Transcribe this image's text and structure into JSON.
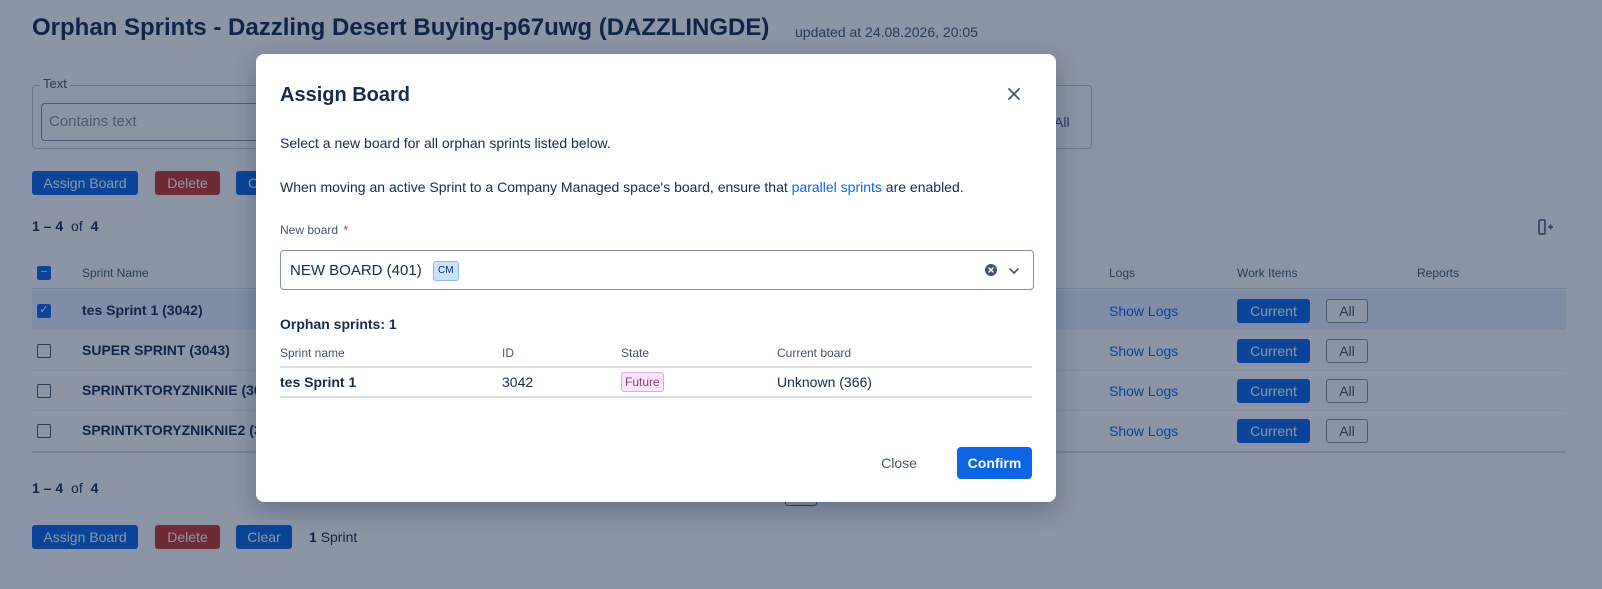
{
  "page": {
    "title": "Orphan Sprints - Dazzling Desert Buying-p67uwg (DAZZLINGDE)",
    "updated": "updated at 24.08.2026, 20:05"
  },
  "filters": {
    "text_legend": "Text",
    "text_placeholder": "Contains text",
    "all_label": "All"
  },
  "toolbar": {
    "assign_label": "Assign Board",
    "delete_label": "Delete",
    "clear_label": "Clear",
    "clear_partial": "C"
  },
  "pagination": {
    "range": "1 – 4",
    "of": "of",
    "total": "4"
  },
  "table": {
    "headers": {
      "sprint_name": "Sprint Name",
      "logs": "Logs",
      "work_items": "Work Items",
      "reports": "Reports"
    },
    "rows": [
      {
        "name": "tes Sprint 1 (3042)",
        "checked": true,
        "logs": "Show Logs",
        "current": "Current",
        "all": "All"
      },
      {
        "name": "SUPER SPRINT (3043)",
        "checked": false,
        "logs": "Show Logs",
        "current": "Current",
        "all": "All"
      },
      {
        "name": "SPRINTKTORYZNIKNIE (30",
        "checked": false,
        "logs": "Show Logs",
        "current": "Current",
        "all": "All"
      },
      {
        "name": "SPRINTKTORYZNIKNIE2 (3",
        "checked": false,
        "logs": "Show Logs",
        "current": "Current",
        "all": "All"
      }
    ]
  },
  "bottom": {
    "selected_count": "1",
    "selected_unit": "Sprint"
  },
  "modal": {
    "title": "Assign Board",
    "description": "Select a new board for all orphan sprints listed below.",
    "note_before": "When moving an active Sprint to a Company Managed space's board, ensure that",
    "note_link": "parallel sprints",
    "note_after": "are enabled.",
    "field_label": "New board",
    "required_mark": "*",
    "selected_board": "NEW BOARD (401)",
    "selected_badge": "CM",
    "orphan_heading": "Orphan sprints: 1",
    "columns": {
      "name": "Sprint name",
      "id": "ID",
      "state": "State",
      "board": "Current board"
    },
    "rows": [
      {
        "name": "tes Sprint 1",
        "id": "3042",
        "state": "Future",
        "board": "Unknown (366)"
      }
    ],
    "close_label": "Close",
    "confirm_label": "Confirm"
  },
  "colors": {
    "primary": "#0c66e4",
    "danger": "#c9372c",
    "overlay": "#091e42",
    "future_badge_bg": "#f8e6ff",
    "future_badge_text": "#943d73"
  }
}
